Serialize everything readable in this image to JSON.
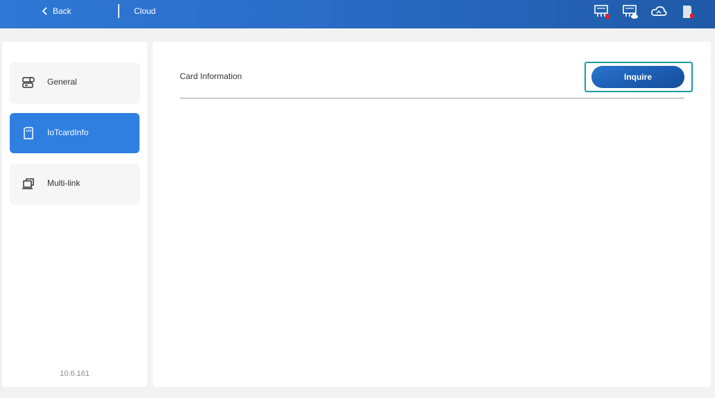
{
  "header": {
    "back_label": "Back",
    "title": "Cloud",
    "status_icons": [
      "network-disconnected-icon",
      "network-cloud-icon",
      "cloud-icon",
      "sd-card-error-icon"
    ]
  },
  "sidebar": {
    "items": [
      {
        "label": "General",
        "icon": "general-settings-icon",
        "active": false
      },
      {
        "label": "IoTcardInfo",
        "icon": "sim-card-icon",
        "active": true
      },
      {
        "label": "Multi-link",
        "icon": "multi-link-icon",
        "active": false
      }
    ],
    "version": "10.6.161"
  },
  "main": {
    "section_title": "Card Information",
    "inquire_label": "Inquire"
  },
  "colors": {
    "header_start": "#2f78d6",
    "header_end": "#1f5aa8",
    "active_nav": "#2f7fe0",
    "button": "#1d5fb4",
    "focus_outline": "#1a9c9a",
    "alert": "#e0202a"
  }
}
